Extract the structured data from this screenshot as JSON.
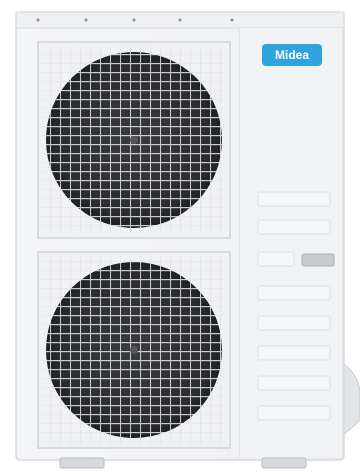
{
  "photo": {
    "subject": "outdoor-air-conditioner-unit",
    "brand_logo_text": "Midea",
    "colors": {
      "body": "#f2f3f5",
      "body_shadow": "#d9dce0",
      "fan_dark": "#2f3033",
      "grille": "#e9eaed",
      "logo_bg": "#2fa3dc"
    },
    "fans": [
      {
        "name": "upper-fan"
      },
      {
        "name": "lower-fan"
      }
    ]
  }
}
